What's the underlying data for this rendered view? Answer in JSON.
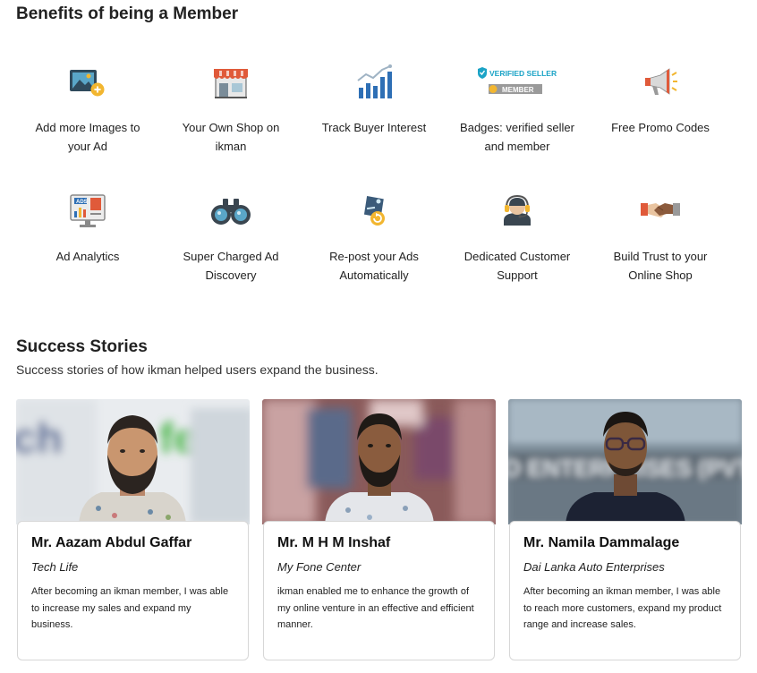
{
  "benefits": {
    "title": "Benefits of being a Member",
    "items": [
      {
        "label": "Add more Images to your Ad",
        "icon": "image-add-icon"
      },
      {
        "label": "Your Own Shop on ikman",
        "icon": "shop-icon"
      },
      {
        "label": "Track Buyer Interest",
        "icon": "growth-chart-icon"
      },
      {
        "label": "Badges: verified seller and member",
        "icon": "badges-icon",
        "badge_verified": "VERIFIED SELLER",
        "badge_member": "MEMBER"
      },
      {
        "label": "Free Promo Codes",
        "icon": "megaphone-icon"
      },
      {
        "label": "Ad Analytics",
        "icon": "analytics-monitor-icon",
        "monitor_text": "ADS"
      },
      {
        "label": "Super Charged Ad Discovery",
        "icon": "binoculars-icon"
      },
      {
        "label": "Re-post your Ads Automatically",
        "icon": "repost-tag-icon"
      },
      {
        "label": "Dedicated Customer Support",
        "icon": "support-headset-icon"
      },
      {
        "label": "Build Trust to your Online Shop",
        "icon": "handshake-icon"
      }
    ]
  },
  "success": {
    "title": "Success Stories",
    "subtitle": "Success stories of how ikman helped users expand the business.",
    "stories": [
      {
        "name": "Mr. Aazam Abdul Gaffar",
        "company": "Tech Life",
        "quote": "After becoming an ikman member, I was able to increase my sales and expand my business."
      },
      {
        "name": "Mr. M H M Inshaf",
        "company": "My Fone Center",
        "quote": "ikman enabled me to enhance the growth of my online venture in an effective and efficient manner."
      },
      {
        "name": "Mr. Namila Dammalage",
        "company": "Dai Lanka Auto Enterprises",
        "quote": "After becoming an ikman member, I was able to reach more customers, expand my product range and increase sales."
      }
    ]
  },
  "colors": {
    "verified": "#1ba3c6",
    "member_badge": "#9a9a9a",
    "gold": "#f2b630",
    "shop_red": "#e05a3a"
  }
}
